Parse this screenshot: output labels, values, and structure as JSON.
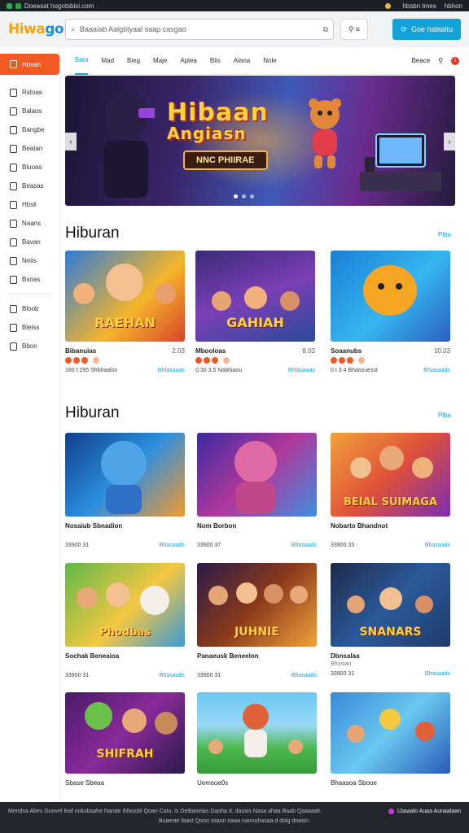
{
  "topstrip": {
    "left_text": "Doeasat hogotsbisi.com",
    "right_items": [
      "hbsbn tmes",
      "hbhon"
    ]
  },
  "header": {
    "logo_a": "Hiwa",
    "logo_b": "go",
    "search_placeholder": "Baaaiab Aalgbtyaal saap casgao",
    "search_btn": "⧉",
    "mid_btn": "⚲ ≡",
    "cta": "Goe hsbtaltu"
  },
  "sidebar": {
    "active": "Hbsan",
    "items": [
      "Rstoas",
      "Balaos",
      "Bangbe",
      "Beatan",
      "Bluoas",
      "Beasas",
      "Hbsli",
      "Naans",
      "Bavan",
      "Neiis",
      "Bsnas"
    ],
    "items2": [
      "Bloob",
      "Bleiss",
      "Bbon"
    ]
  },
  "tabs": {
    "items": [
      "Bata",
      "Mad",
      "Bieg",
      "Maje",
      "Aplea",
      "Blis",
      "Alana",
      "Nole"
    ],
    "right_label": "Beace",
    "badge": "1"
  },
  "banner": {
    "title_1": "Hibaan",
    "title_2": "Angiasn",
    "subtitle": "NNC PHIIRAE"
  },
  "section1": {
    "title": "Hiburan",
    "more": "Plba",
    "cards": [
      {
        "thumb_text": "RAEHAN",
        "name": "Bibanuias",
        "name2": "2.03",
        "meta": "180 t 295 Shbhaalsn",
        "link": "Bhfasaaas",
        "rating": 3
      },
      {
        "thumb_text": "GAHIAH",
        "name": "Mbooloas",
        "name2": "8.03",
        "meta": "0.30 3.5 Nabhiaou",
        "link": "Bhfasaaas",
        "rating": 3
      },
      {
        "thumb_text": "",
        "name": "Soaanubs",
        "name2": "10.03",
        "meta": "0 t 3 4 Bhaosuesst",
        "link": "Bhiasaads",
        "rating": 3
      }
    ]
  },
  "section2": {
    "title": "Hiburan",
    "more": "Plba",
    "cards": [
      {
        "thumb_text": "",
        "name": "Nosaiub Sbnadion",
        "sub": "",
        "meta": "33900 31",
        "link": "Bhasaads"
      },
      {
        "thumb_text": "",
        "name": "Nom Borbon",
        "sub": "",
        "meta": "33900 37",
        "link": "Bhasaads"
      },
      {
        "thumb_text": "BEIAL SUIMAGA",
        "name": "Nobarto Bhandnot",
        "sub": "",
        "meta": "33900 33",
        "link": "Bhasaads"
      },
      {
        "thumb_text": "Phodbas",
        "name": "Sochak Beneaioa",
        "sub": "",
        "meta": "33900 31",
        "link": "Bhasaads"
      },
      {
        "thumb_text": "JUHNIE",
        "name": "Panaeusk Beneelon",
        "sub": "",
        "meta": "33900 31",
        "link": "Bhasaads"
      },
      {
        "thumb_text": "SNANARS",
        "name": "Dbnsalaa",
        "sub": "Bhosiao",
        "meta": "33900 31",
        "link": "Bhasaads"
      },
      {
        "thumb_text": "SHIFRAH",
        "name": "Sbase Sbeaa",
        "sub": "",
        "meta": "",
        "link": ""
      },
      {
        "thumb_text": "",
        "name": "Uemsoe0s",
        "sub": "",
        "meta": "",
        "link": ""
      },
      {
        "thumb_text": "",
        "name": "Bhaasoa Sbooe",
        "sub": "",
        "meta": "",
        "link": ""
      }
    ]
  },
  "footer": {
    "line1": "Mendsa Abes Gnovel leaf noksbaahe Nande ihfasobl Qoan Catu. is Deibaneias Daoha d. dausis Nasa ahaa Baab Qaaaaah.",
    "line1_right": "Lbaaalo Auaa Aunaalaan",
    "line2": "Buaeste faast Qono ssaon naaa nannuhasaa d dolg dnasin."
  },
  "colors": {
    "accent": "#f15a22",
    "link": "#13a3d8",
    "footer_bg": "#23262d"
  }
}
